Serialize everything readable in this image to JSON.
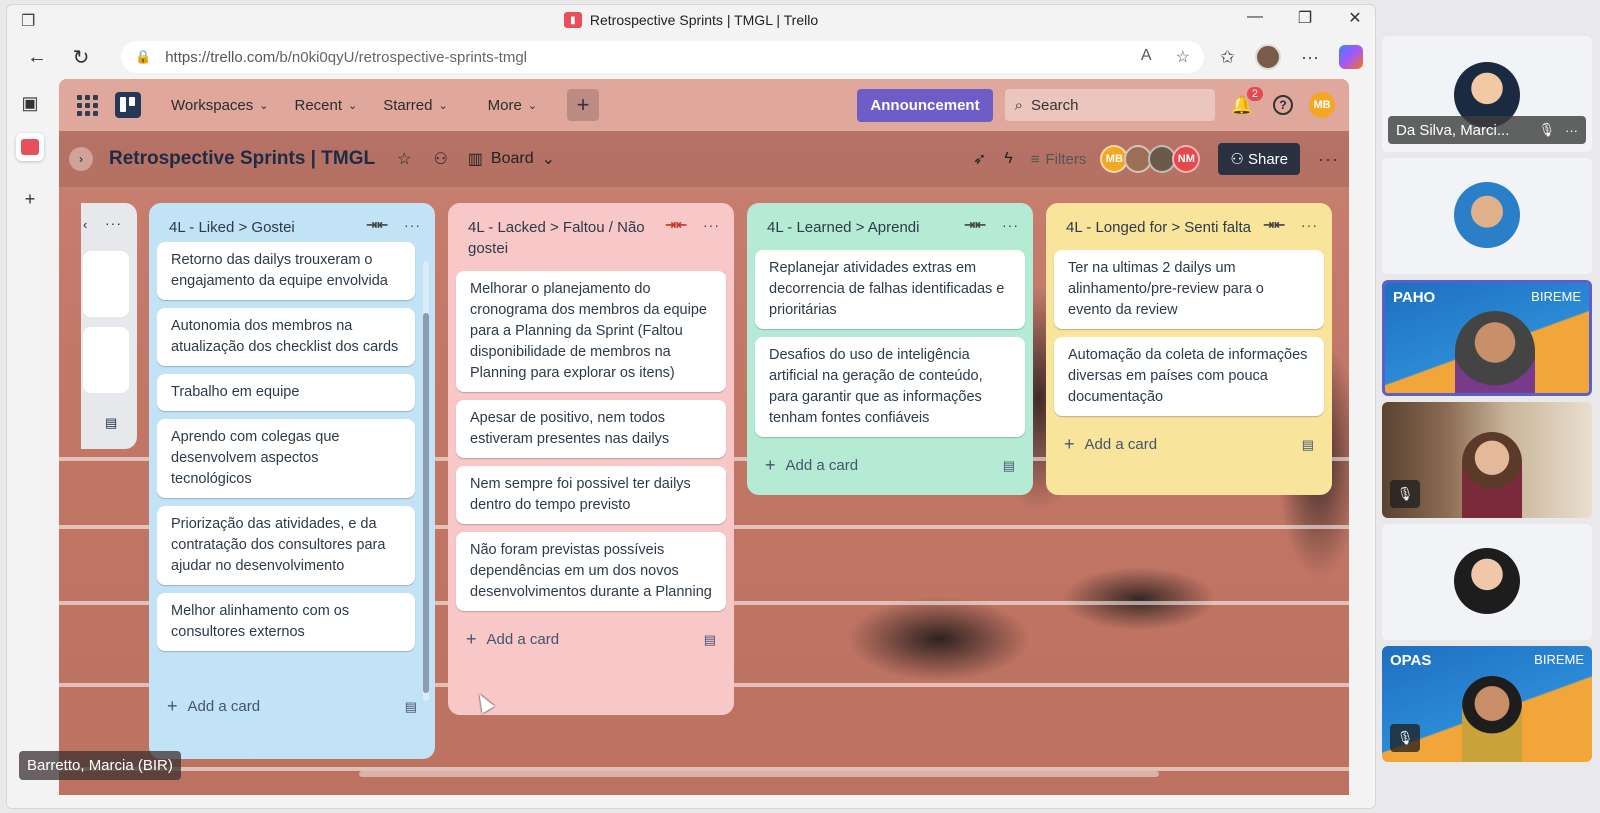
{
  "browser": {
    "tab_title": "Retrospective Sprints | TMGL | Trello",
    "url_host": "https://trello.com",
    "url_path": "/b/n0ki0qyU/retrospective-sprints-tmgl"
  },
  "topnav": {
    "workspaces": "Workspaces",
    "recent": "Recent",
    "starred": "Starred",
    "more": "More",
    "announcement": "Announcement",
    "search_placeholder": "Search",
    "notifications_count": "2",
    "user_initials": "MB"
  },
  "board": {
    "title": "Retrospective Sprints | TMGL",
    "view": "Board",
    "filters": "Filters",
    "share": "Share",
    "members": [
      "MB",
      "",
      "",
      "NM"
    ]
  },
  "lists": [
    {
      "name": "4L - Liked > Gostei",
      "cards": [
        "Retorno das dailys trouxeram o engajamento da equipe envolvida",
        "Autonomia dos membros na atualização dos checklist dos cards",
        "Trabalho em equipe",
        "Aprendo com colegas que desenvolvem aspectos tecnológicos",
        "Priorização das atividades, e da contratação dos consultores para ajudar no desenvolvimento",
        "Melhor alinhamento com os consultores externos"
      ],
      "add_card": "Add a card"
    },
    {
      "name": "4L - Lacked > Faltou / Não gostei",
      "cards": [
        "Melhorar o planejamento do cronograma dos membros da equipe para a Planning da Sprint (Faltou disponibilidade de membros na Planning para explorar os itens)",
        "Apesar de positivo, nem todos estiveram presentes nas dailys",
        "Nem sempre foi possivel ter dailys dentro do tempo previsto",
        "Não foram previstas possíveis dependências em um dos novos desenvolvimentos durante a Planning"
      ],
      "add_card": "Add a card"
    },
    {
      "name": "4L - Learned > Aprendi",
      "cards": [
        "Replanejar atividades extras em decorrencia de falhas identificadas e prioritárias",
        "Desafios do uso de inteligência artificial na geração de conteúdo, para garantir que as informações tenham fontes confiáveis"
      ],
      "add_card": "Add a card"
    },
    {
      "name": "4L - Longed for > Senti falta",
      "cards": [
        "Ter na ultimas 2 dailys um alinhamento/pre-review para o evento da review",
        "Automação da coleta de informações diversas em países com pouca documentação"
      ],
      "add_card": "Add a card"
    }
  ],
  "caption": "Barretto, Marcia (BIR)",
  "participants": {
    "first_name": "Da Silva, Marci...",
    "org_paho": "PAHO",
    "org_opas": "OPAS",
    "org_bireme": "BIREME"
  },
  "colors": {
    "liked": "#c2e2f5",
    "lacked": "#f8c7c7",
    "learned": "#b5ebd5",
    "longed": "#f8e49a",
    "announcement": "#6e5dc6"
  }
}
